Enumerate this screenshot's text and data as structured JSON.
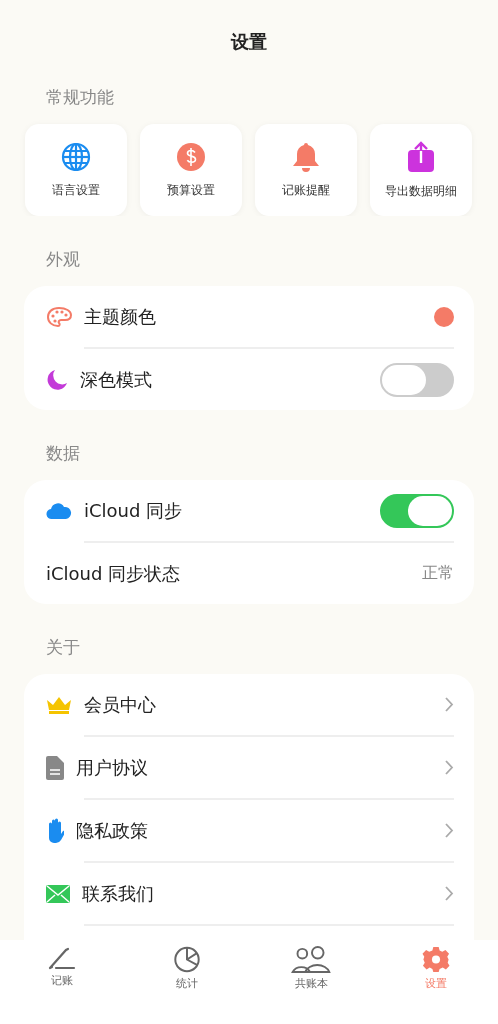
{
  "title": "设置",
  "general": {
    "header": "常规功能",
    "tiles": [
      {
        "label": "语言设置"
      },
      {
        "label": "预算设置"
      },
      {
        "label": "记账提醒"
      },
      {
        "label": "导出数据明细"
      }
    ]
  },
  "sections": [
    {
      "header": "外观",
      "rows": [
        {
          "kind": "color",
          "label": "主题颜色",
          "color": "#f47b67"
        },
        {
          "kind": "toggle",
          "label": "深色模式",
          "on": false
        }
      ]
    },
    {
      "header": "数据",
      "rows": [
        {
          "kind": "toggle",
          "label": "iCloud 同步",
          "on": true
        },
        {
          "kind": "value",
          "label": "iCloud 同步状态",
          "value": "正常"
        }
      ]
    },
    {
      "header": "关于",
      "rows": [
        {
          "kind": "link",
          "label": "会员中心"
        },
        {
          "kind": "link",
          "label": "用户协议"
        },
        {
          "kind": "link",
          "label": "隐私政策"
        },
        {
          "kind": "link",
          "label": "联系我们"
        }
      ]
    }
  ],
  "tabs": [
    {
      "label": "记账",
      "selected": false
    },
    {
      "label": "统计",
      "selected": false
    },
    {
      "label": "共账本",
      "selected": false
    },
    {
      "label": "设置",
      "selected": true
    }
  ]
}
